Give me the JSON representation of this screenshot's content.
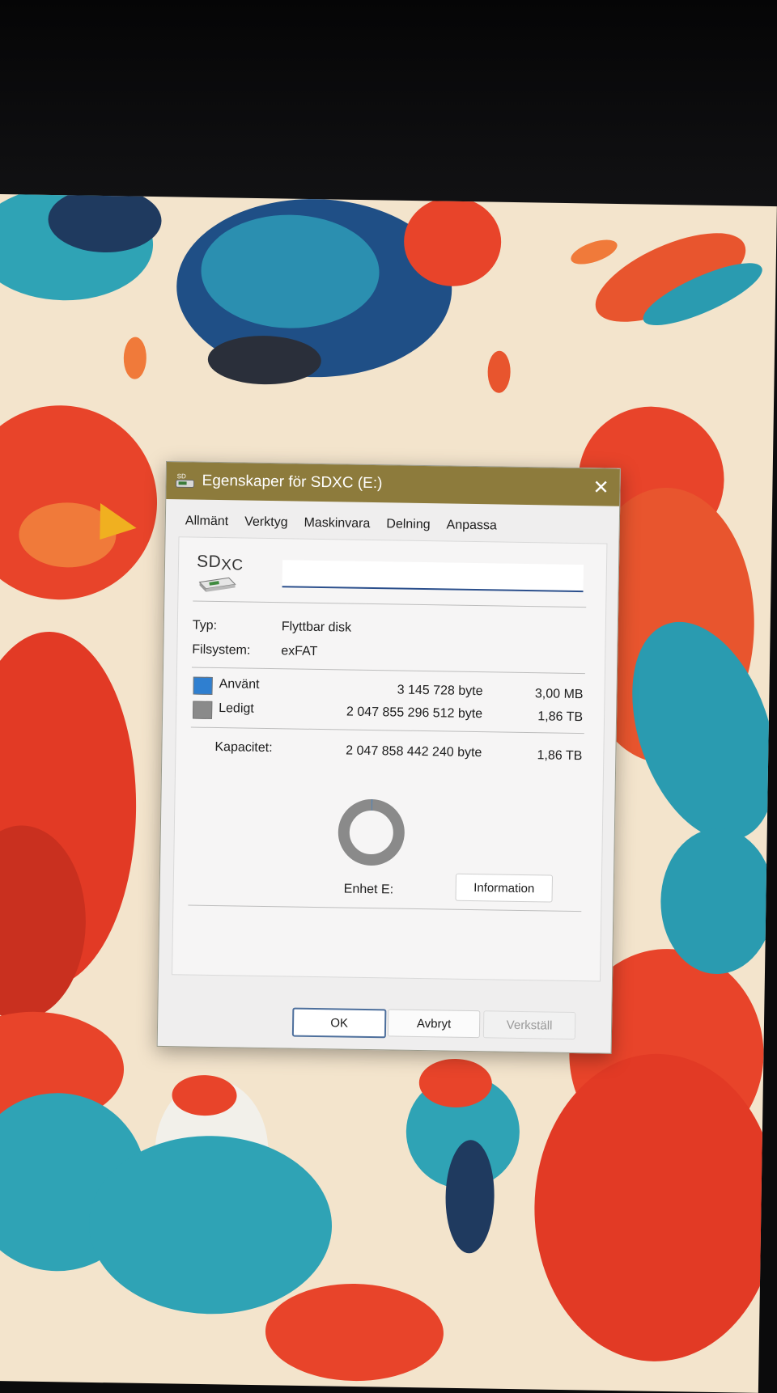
{
  "window": {
    "title": "Egenskaper för SDXC (E:)",
    "close_glyph": "✕"
  },
  "tabs": [
    {
      "label": "Allmänt"
    },
    {
      "label": "Verktyg"
    },
    {
      "label": "Maskinvara"
    },
    {
      "label": "Delning"
    },
    {
      "label": "Anpassa"
    }
  ],
  "general": {
    "drive_icon_text": "SD",
    "drive_icon_sub": "XC",
    "name_value": "",
    "type_label": "Typ:",
    "type_value": "Flyttbar disk",
    "fs_label": "Filsystem:",
    "fs_value": "exFAT",
    "used": {
      "label": "Använt",
      "bytes": "3 145 728 byte",
      "size": "3,00 MB",
      "color": "#2f7fd0"
    },
    "free": {
      "label": "Ledigt",
      "bytes": "2 047 855 296 512 byte",
      "size": "1,86 TB",
      "color": "#8a8a8a"
    },
    "capacity": {
      "label": "Kapacitet:",
      "bytes": "2 047 858 442 240 byte",
      "size": "1,86 TB"
    },
    "drive_letter": "Enhet E:",
    "info_button": "Information"
  },
  "footer": {
    "ok": "OK",
    "cancel": "Avbryt",
    "apply": "Verkställ"
  },
  "wallpaper": {
    "description_colors": [
      "#f3e4cc",
      "#e8442a",
      "#2a9bb0",
      "#1f3a5f",
      "#f0a040"
    ]
  }
}
